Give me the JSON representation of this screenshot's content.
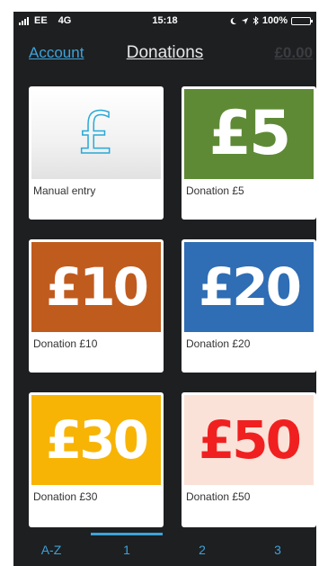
{
  "status_bar": {
    "carrier": "EE",
    "network": "4G",
    "time": "15:18",
    "icons": [
      "moon-icon",
      "location-arrow-icon",
      "bluetooth-icon"
    ],
    "battery": "100%",
    "battery_level": 1.0
  },
  "nav": {
    "account_label": "Account",
    "title": "Donations",
    "total": "£0.00"
  },
  "tiles": [
    {
      "type": "manual",
      "icon": "pound-sign-icon",
      "label": "Manual entry"
    },
    {
      "type": "amount",
      "amount": "£5",
      "label": "Donation £5",
      "bg": "#5e8a36",
      "fg": "#ffffff"
    },
    {
      "type": "amount",
      "amount": "£10",
      "label": "Donation £10",
      "bg": "#c05b1e",
      "fg": "#ffffff"
    },
    {
      "type": "amount",
      "amount": "£20",
      "label": "Donation £20",
      "bg": "#2f6db4",
      "fg": "#ffffff"
    },
    {
      "type": "amount",
      "amount": "£30",
      "label": "Donation £30",
      "bg": "#f8b404",
      "fg": "#ffffff"
    },
    {
      "type": "amount",
      "amount": "£50",
      "label": "Donation £50",
      "bg": "#fbe2d8",
      "fg": "#f02020"
    }
  ],
  "tabs": [
    {
      "label": "A-Z",
      "active": false
    },
    {
      "label": "1",
      "active": true
    },
    {
      "label": "2",
      "active": false
    },
    {
      "label": "3",
      "active": false
    }
  ],
  "colors": {
    "accent": "#3fa2d9",
    "background": "#1d1f21",
    "battery": "#4cd964"
  }
}
